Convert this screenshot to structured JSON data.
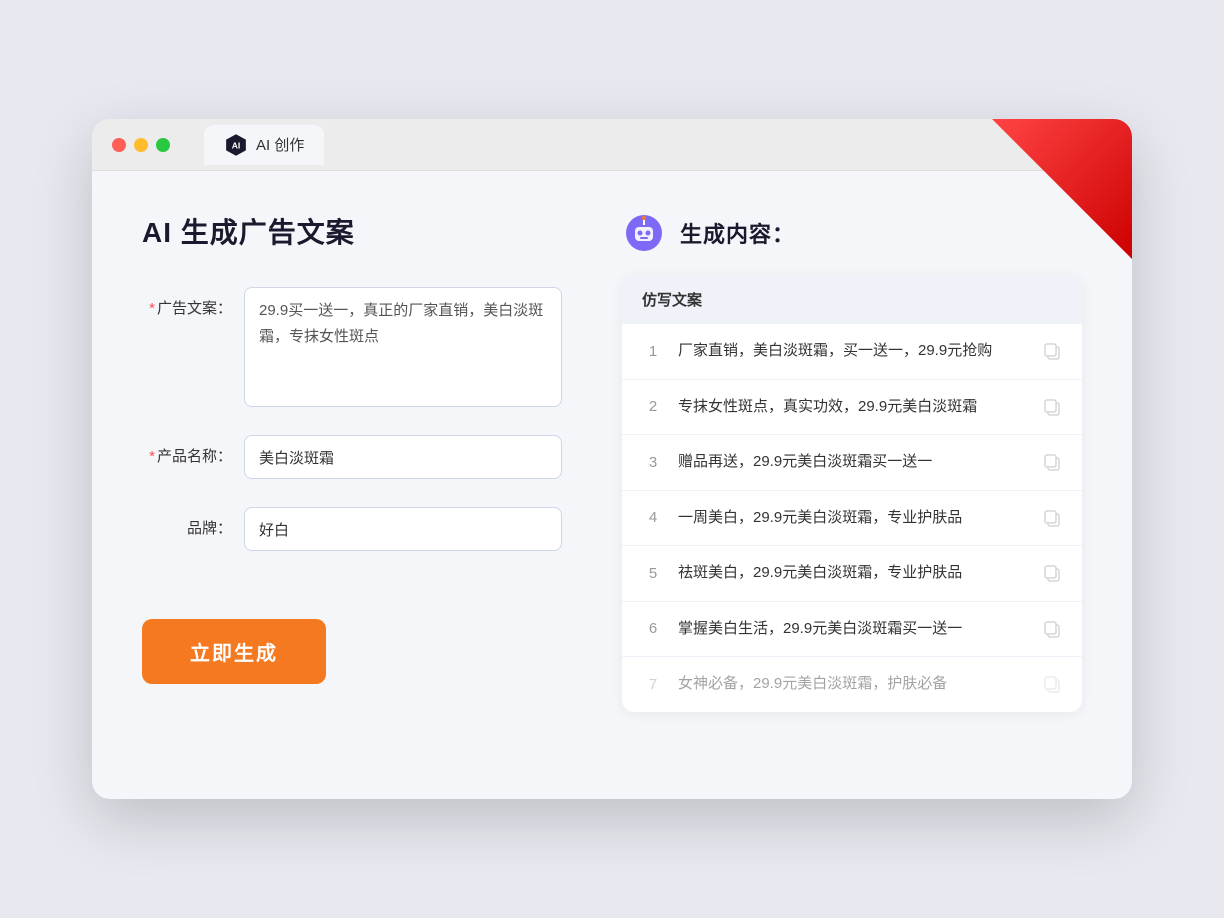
{
  "tab": {
    "label": "AI 创作"
  },
  "page": {
    "title": "AI 生成广告文案",
    "right_title": "生成内容："
  },
  "form": {
    "ad_label": "广告文案：",
    "ad_required": "*",
    "ad_value": "29.9买一送一，真正的厂家直销，美白淡斑霜，专抹女性斑点",
    "product_label": "产品名称：",
    "product_required": "*",
    "product_value": "美白淡斑霜",
    "brand_label": "品牌：",
    "brand_value": "好白",
    "generate_btn": "立即生成"
  },
  "results": {
    "header": "仿写文案",
    "items": [
      {
        "num": "1",
        "text": "厂家直销，美白淡斑霜，买一送一，29.9元抢购"
      },
      {
        "num": "2",
        "text": "专抹女性斑点，真实功效，29.9元美白淡斑霜"
      },
      {
        "num": "3",
        "text": "赠品再送，29.9元美白淡斑霜买一送一"
      },
      {
        "num": "4",
        "text": "一周美白，29.9元美白淡斑霜，专业护肤品"
      },
      {
        "num": "5",
        "text": "祛斑美白，29.9元美白淡斑霜，专业护肤品"
      },
      {
        "num": "6",
        "text": "掌握美白生活，29.9元美白淡斑霜买一送一"
      },
      {
        "num": "7",
        "text": "女神必备，29.9元美白淡斑霜，护肤必备",
        "faded": true
      }
    ]
  }
}
